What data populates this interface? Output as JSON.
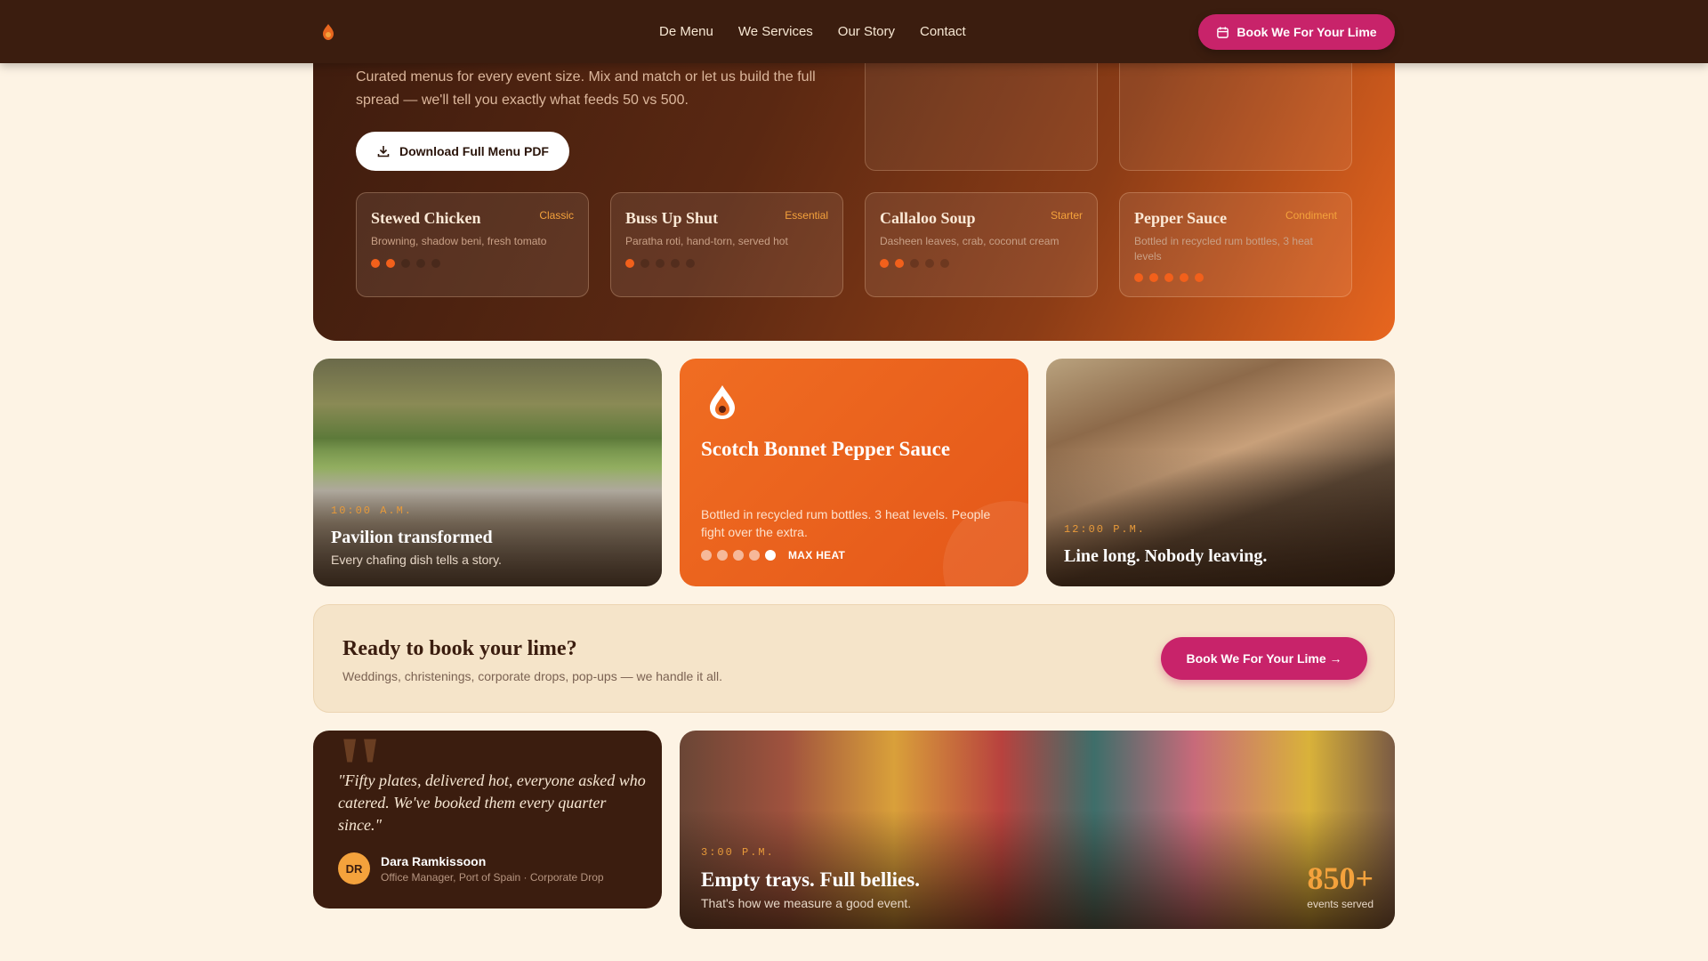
{
  "nav": {
    "links": [
      "De Menu",
      "We Services",
      "Our Story",
      "Contact"
    ],
    "cta_label": "Book We For Your Lime"
  },
  "hero": {
    "description": "Curated menus for every event size. Mix and match or let us build the full spread — we'll tell you exactly what feeds 50 vs 500.",
    "download_label": "Download Full Menu PDF",
    "menu_items": [
      {
        "name": "Stewed Chicken",
        "tag": "Classic",
        "desc": "Browning, shadow beni, fresh tomato",
        "heat": 2
      },
      {
        "name": "Buss Up Shut",
        "tag": "Essential",
        "desc": "Paratha roti, hand-torn, served hot",
        "heat": 1
      },
      {
        "name": "Callaloo Soup",
        "tag": "Starter",
        "desc": "Dasheen leaves, crab, coconut cream",
        "heat": 2
      },
      {
        "name": "Pepper Sauce",
        "tag": "Condiment",
        "desc": "Bottled in recycled rum bottles, 3 heat levels",
        "heat": 5
      }
    ]
  },
  "gallery": {
    "pavilion": {
      "time": "10:00 A.M.",
      "title": "Pavilion transformed",
      "caption": "Every chafing dish tells a story."
    },
    "pepper": {
      "title": "Scotch Bonnet Pepper Sauce",
      "desc": "Bottled in recycled rum bottles. 3 heat levels. People fight over the extra.",
      "heat_label": "MAX HEAT",
      "heat_level": 5
    },
    "line": {
      "time": "12:00 P.M.",
      "title": "Line long. Nobody leaving."
    }
  },
  "banner": {
    "heading": "Ready to book your lime?",
    "sub": "Weddings, christenings, corporate drops, pop-ups — we handle it all.",
    "button": "Book We For Your Lime →"
  },
  "testimonial": {
    "quote": "\"Fifty plates, delivered hot, everyone asked who catered. We've booked them every quarter since.\"",
    "initials": "DR",
    "name": "Dara Ramkissoon",
    "role": "Office Manager, Port of Spain · Corporate Drop"
  },
  "party": {
    "time": "3:00 P.M.",
    "title": "Empty trays. Full bellies.",
    "caption": "That's how we measure a good event.",
    "stat_value": "850+",
    "stat_label": "events served"
  },
  "colors": {
    "brand_dark": "#3b1d0f",
    "accent_pink": "#c8236a",
    "accent_orange": "#f06d22",
    "gold": "#f4a23c"
  }
}
